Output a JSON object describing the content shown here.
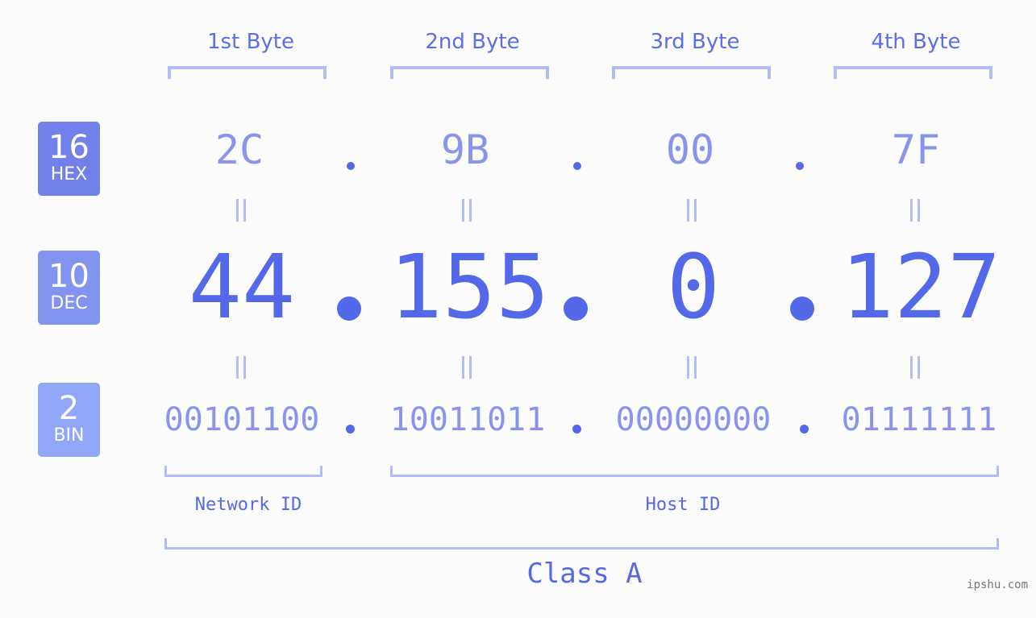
{
  "bytes": {
    "headers": [
      "1st Byte",
      "2nd Byte",
      "3rd Byte",
      "4th Byte"
    ],
    "hex": [
      "2C",
      "9B",
      "00",
      "7F"
    ],
    "dec": [
      "44",
      "155",
      "0",
      "127"
    ],
    "bin": [
      "00101100",
      "10011011",
      "00000000",
      "01111111"
    ]
  },
  "badges": {
    "hex": {
      "number": "16",
      "label": "HEX",
      "color": "#7280ea"
    },
    "dec": {
      "number": "10",
      "label": "DEC",
      "color": "#8293f0"
    },
    "bin": {
      "number": "2",
      "label": "BIN",
      "color": "#8fa7f6"
    }
  },
  "equals_sign": "=",
  "separator": ".",
  "ids": {
    "network": "Network ID",
    "host": "Host ID"
  },
  "ip_class": "Class A",
  "watermark": "ipshu.com",
  "colors": {
    "primary": "#5468ea",
    "light": "#8a93ee",
    "bracket": "#b3bcf6",
    "background": "#fbfcfb"
  }
}
